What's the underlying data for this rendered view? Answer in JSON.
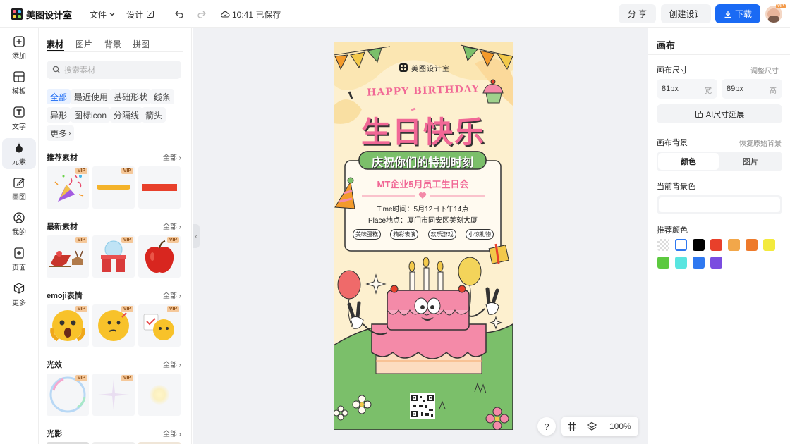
{
  "topbar": {
    "app_name": "美图设计室",
    "menu_file": "文件",
    "menu_design": "设计",
    "save_status": "10:41 已保存",
    "share": "分 享",
    "create_design": "创建设计",
    "download": "下载",
    "avatar_badge": "VIP"
  },
  "rail": {
    "items": [
      {
        "label": "添加",
        "icon": "plus-square-icon"
      },
      {
        "label": "模板",
        "icon": "template-icon"
      },
      {
        "label": "文字",
        "icon": "text-icon"
      },
      {
        "label": "元素",
        "icon": "shapes-icon"
      },
      {
        "label": "画图",
        "icon": "draw-icon"
      },
      {
        "label": "我的",
        "icon": "user-icon"
      },
      {
        "label": "页面",
        "icon": "page-add-icon"
      },
      {
        "label": "更多",
        "icon": "cube-icon"
      }
    ]
  },
  "panel": {
    "tabs": [
      "素材",
      "图片",
      "背景",
      "拼图"
    ],
    "search_placeholder": "搜索素材",
    "chips": [
      "全部",
      "最近使用",
      "基础形状",
      "线条",
      "异形",
      "图标icon",
      "分隔线",
      "箭头",
      "更多"
    ],
    "sections": [
      {
        "title": "推荐素材",
        "all": "全部"
      },
      {
        "title": "最新素材",
        "all": "全部"
      },
      {
        "title": "emoji表情",
        "all": "全部"
      },
      {
        "title": "光效",
        "all": "全部"
      },
      {
        "title": "光影",
        "all": "全部"
      }
    ],
    "vip": "VIP"
  },
  "poster": {
    "brand": "美图设计室",
    "happy": "HAPPY BIRTHDAY",
    "headline": "生日快乐",
    "banner": "庆祝你们的特别时刻",
    "event": "MT企业5月员工生日会",
    "time": "Time时间：5月12日下午14点",
    "place": "Place地点：厦门市同安区美刻大厦",
    "tags": [
      "美味蛋糕",
      "精彩表演",
      "欢乐游戏",
      "小惊礼物"
    ]
  },
  "canvas_tools": {
    "help": "?",
    "zoom": "100%"
  },
  "right": {
    "title": "画布",
    "size_label": "画布尺寸",
    "adjust_size": "调整尺寸",
    "width_value": "81px",
    "width_unit": "宽",
    "height_value": "89px",
    "height_unit": "高",
    "ai_extend": "AI尺寸延展",
    "bg_label": "画布背景",
    "restore_bg": "恢复原始背景",
    "seg_color": "颜色",
    "seg_image": "图片",
    "current_bg": "当前背景色",
    "recommend": "推荐颜色",
    "colors": [
      "transparent",
      "#ffffff",
      "#000000",
      "#e8402b",
      "#f2a74a",
      "#ee7a2b",
      "#f3ea3d",
      "#5cc93f",
      "#59e5e0",
      "#2f78f0",
      "#7a4de0"
    ],
    "accent": "#1a6af4"
  }
}
